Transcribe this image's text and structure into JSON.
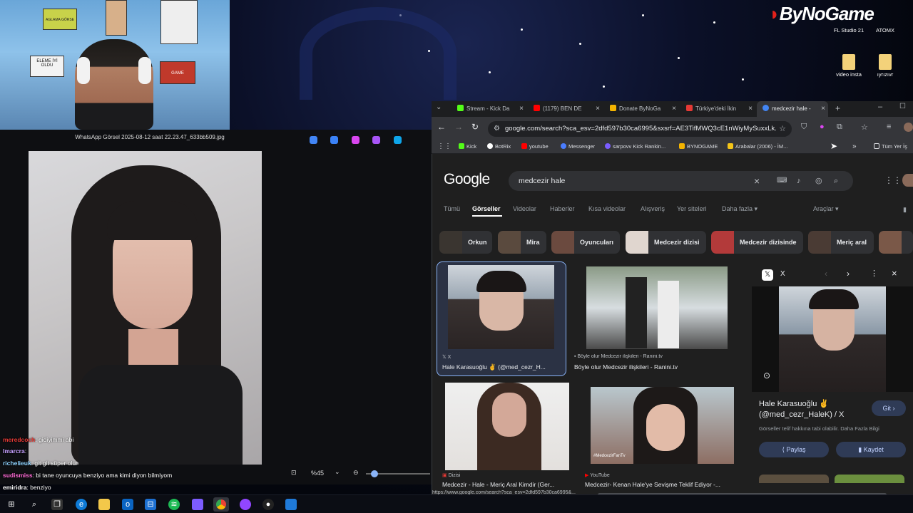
{
  "stream_logo": {
    "text": "ByNoGame"
  },
  "desktop_icons": [
    {
      "label": "FL Studio 21"
    },
    {
      "label": "ATOMX"
    },
    {
      "label": "video insta"
    },
    {
      "label": "ıyrızıvr"
    }
  ],
  "webcam": {
    "posters": [
      "AGLAMA GÖRSE",
      "ELEME İYİ OLDU",
      "GAME"
    ]
  },
  "photo_viewer": {
    "title": "WhatsApp Görsel 2025-08-12 saat 22.23.47_633bb509.jpg",
    "zoom": "%45"
  },
  "chat": [
    {
      "user": "meredcoch",
      "text": ": gidiyimmi abi",
      "color": "#e53935"
    },
    {
      "user": "lmarcra",
      "text": ":",
      "color": "#c6a0ff"
    },
    {
      "user": "richelieuk",
      "text": ": git git süper olur",
      "color": "#8fd3ff"
    },
    {
      "user": "sudismiss",
      "text": ": bi tane oyuncuya benziyo ama kimi diyon bilmiyom",
      "color": "#ff6bd6"
    },
    {
      "user": "emiridra",
      "text": ": benziyo",
      "color": "#ffffff"
    }
  ],
  "browser": {
    "tabs": [
      {
        "label": "Stream - Kick Da",
        "color": "#53fc18"
      },
      {
        "label": "(1179) BEN DE",
        "color": "#ff0000"
      },
      {
        "label": "Donate ByNoGa",
        "color": "#f4b400"
      },
      {
        "label": "Türkiye'deki İkin",
        "color": "#e53935"
      },
      {
        "label": "medcezir hale -",
        "color": "#4285f4"
      }
    ],
    "url": "google.com/search?sca_esv=2dfd597b30ca6995&sxsrf=AE3TifMWQ3cE1nWiyMySuxxLk...",
    "bookmarks": [
      {
        "label": "Kick",
        "color": "#53fc18"
      },
      {
        "label": "BotRix",
        "color": "#ffffff"
      },
      {
        "label": "youtube",
        "color": "#ff0000"
      },
      {
        "label": "Messenger",
        "color": "#4a7dff"
      },
      {
        "label": "sarpovv Kick Rankin...",
        "color": "#7a5cff"
      },
      {
        "label": "BYNOGAME",
        "color": "#f4b400"
      },
      {
        "label": "Arabalar (2006) - İM...",
        "color": "#f5c518"
      },
      {
        "label": "Tüm Yer İş",
        "color": "#dadce0"
      }
    ],
    "status_url": "https://www.google.com/search?sca_esv=2dfd597b30ca6995&..."
  },
  "google": {
    "logo": "Google",
    "query": "medcezir hale",
    "nav_tabs": [
      "Tümü",
      "Görseller",
      "Videolar",
      "Haberler",
      "Kısa videolar",
      "Alışveriş",
      "Yer siteleri",
      "Daha fazla"
    ],
    "tools_label": "Araçlar",
    "chips": [
      "Orkun",
      "Mira",
      "Oyuncuları",
      "Medcezir dizisi",
      "Medcezir dizisinde",
      "Meriç aral"
    ],
    "results": [
      {
        "source": "X",
        "caption": "Hale Karasuoğlu ✌️ (@med_cezr_H..."
      },
      {
        "source": "Böyle olur Medcezir ilişkileri - Ranini.tv",
        "caption": "Böyle olur Medcezir ilişkileri - Ranini.tv"
      },
      {
        "source": "Dizisi",
        "caption": "Medcezir - Hale - Meriç Aral Kimdir (Ger..."
      },
      {
        "source": "YouTube",
        "caption": "Medcezir- Kenan Hale'ye Sevişme Teklif Ediyor -..."
      }
    ],
    "watermark": "#MedcezirFanTv"
  },
  "side_panel": {
    "source": "X",
    "title": "Hale Karasuoğlu ✌️ (@med_cezr_HaleK) / X",
    "visit": "Git",
    "copyright": "Görseller telif hakkına tabi olabilir. Daha Fazla Bilgi",
    "share": "Paylaş",
    "save": "Kaydet"
  },
  "colors": {
    "google_blue": "#8ab4f8",
    "chrome_bg": "#202124",
    "toolbar": "#35363a"
  }
}
